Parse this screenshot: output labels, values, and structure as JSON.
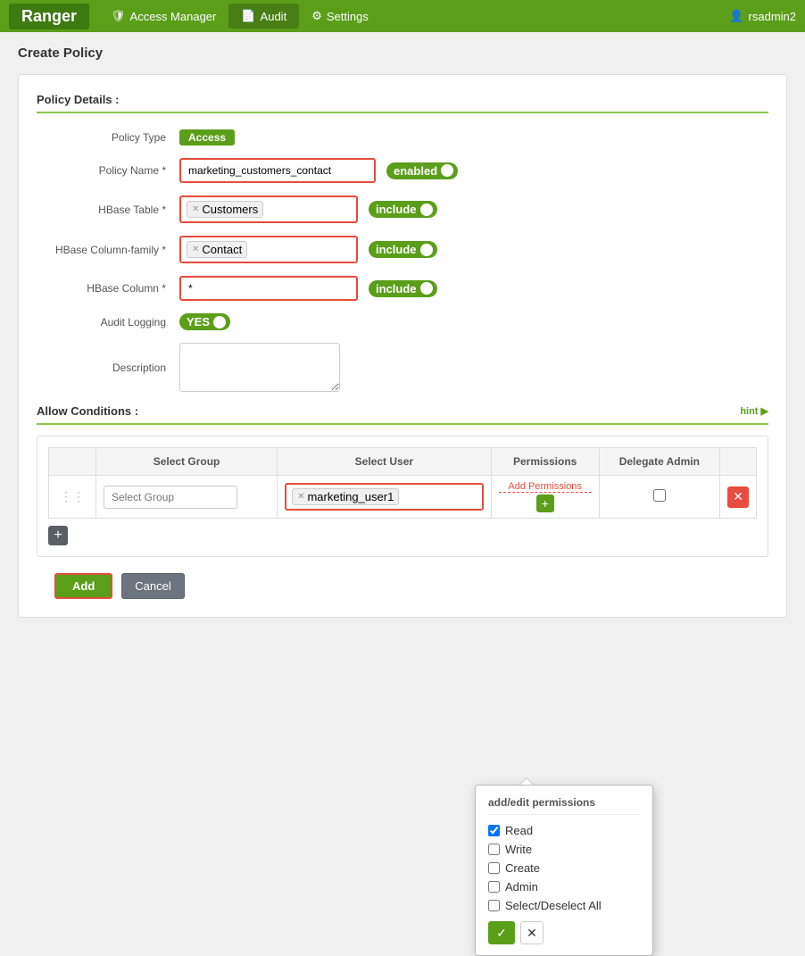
{
  "nav": {
    "brand": "Ranger",
    "items": [
      {
        "label": "Access Manager",
        "icon": "shield",
        "active": false
      },
      {
        "label": "Audit",
        "icon": "doc",
        "active": true
      },
      {
        "label": "Settings",
        "icon": "gear",
        "active": false
      }
    ],
    "user": "rsadmin2"
  },
  "page": {
    "title": "Create Policy"
  },
  "policy_details": {
    "section_title": "Policy Details :",
    "policy_type_label": "Policy Type",
    "policy_type_badge": "Access",
    "policy_name_label": "Policy Name *",
    "policy_name_value": "marketing_customers_contact",
    "policy_name_toggle": "enabled",
    "hbase_table_label": "HBase Table *",
    "hbase_table_tag": "Customers",
    "hbase_table_toggle": "include",
    "hbase_column_family_label": "HBase Column-family *",
    "hbase_column_family_tag": "Contact",
    "hbase_column_family_toggle": "include",
    "hbase_column_label": "HBase Column *",
    "hbase_column_value": "*",
    "hbase_column_toggle": "include",
    "audit_logging_label": "Audit Logging",
    "audit_logging_toggle": "YES",
    "description_label": "Description",
    "description_placeholder": ""
  },
  "allow_conditions": {
    "section_title": "Allow Conditions :",
    "hint": "hint ▶",
    "col_select_group": "Select Group",
    "col_select_user": "Select User",
    "col_permissions": "Permissions",
    "col_delegate_admin": "Delegate Admin",
    "row": {
      "select_group_placeholder": "Select Group",
      "select_user_tag": "marketing_user1",
      "add_permissions_label": "Add Permissions",
      "add_permissions_btn": "+"
    }
  },
  "permissions_popup": {
    "title": "add/edit permissions",
    "items": [
      {
        "label": "Read",
        "checked": true
      },
      {
        "label": "Write",
        "checked": false
      },
      {
        "label": "Create",
        "checked": false
      },
      {
        "label": "Admin",
        "checked": false
      },
      {
        "label": "Select/Deselect All",
        "checked": false
      }
    ],
    "ok_icon": "✓",
    "cancel_icon": "✕"
  },
  "buttons": {
    "add_label": "Add",
    "cancel_label": "Cancel"
  }
}
